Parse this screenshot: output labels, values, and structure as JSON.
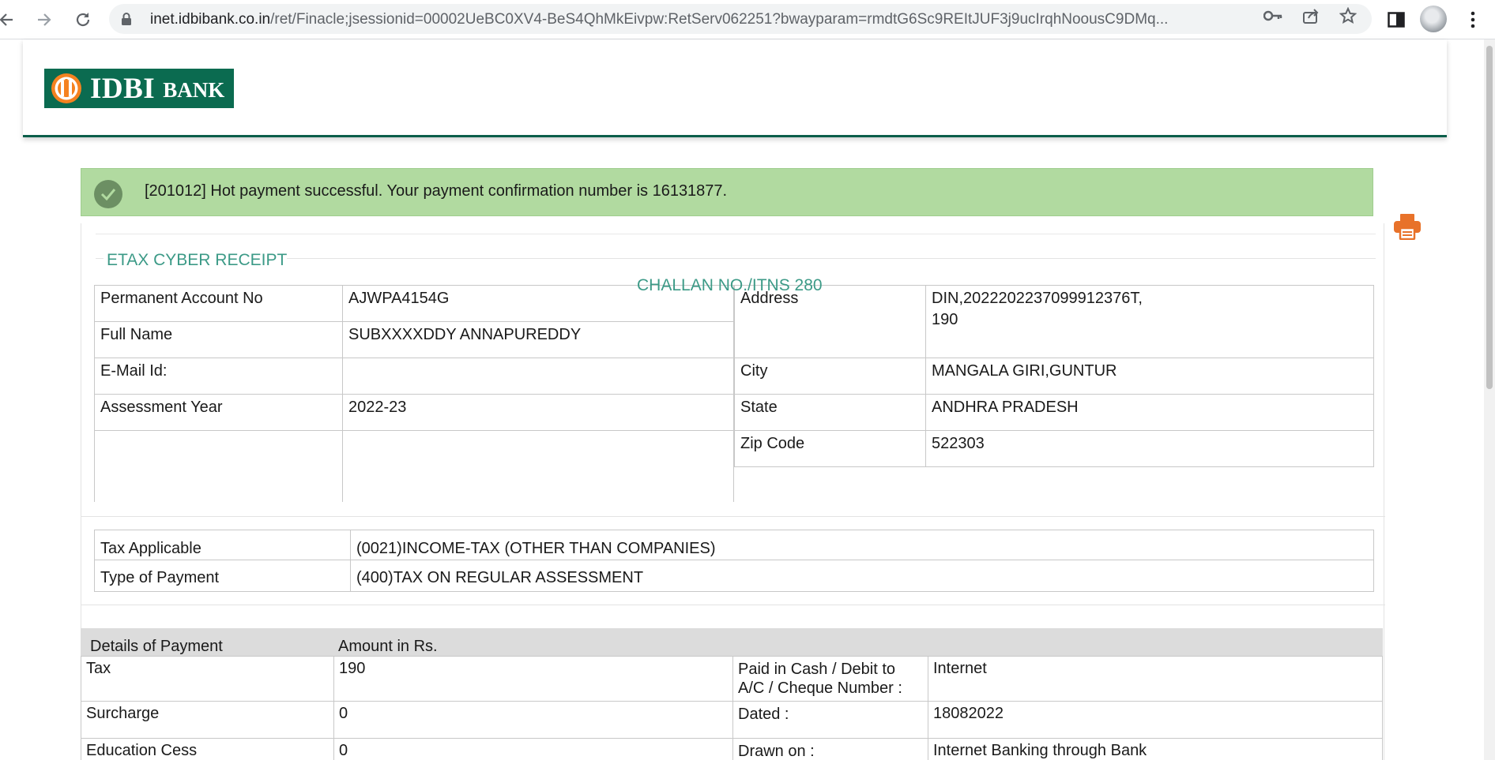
{
  "browser": {
    "url_host": "inet.idbibank.co.in",
    "url_path": "/ret/Finacle;jsessionid=00002UeBC0XV4-BeS4QhMkEivpw:RetServ062251?bwayparam=rmdtG6Sc9REItJUF3j9ucIrqhNoousC9DMq..."
  },
  "brand": {
    "name_part1": "IDBI",
    "name_part2": "BANK",
    "color": "#0b6b50"
  },
  "alert": {
    "message": "[201012] Hot payment successful. Your payment confirmation number is 16131877.",
    "color": "#b1daa0"
  },
  "receipt": {
    "legend": "ETAX CYBER RECEIPT",
    "challan": "CHALLAN NO./ITNS 280",
    "left_rows": [
      {
        "label": "Permanent Account No",
        "value": "AJWPA4154G"
      },
      {
        "label": "Full Name",
        "value": "SUBXXXXDDY ANNAPUREDDY"
      },
      {
        "label": "E-Mail Id:",
        "value": ""
      },
      {
        "label": "Assessment Year",
        "value": "2022-23"
      }
    ],
    "right_rows": [
      {
        "label": "Address",
        "value_line1": "DIN,2022202237099912376T,",
        "value_line2": "190"
      },
      {
        "label": "City",
        "value": "MANGALA GIRI,GUNTUR"
      },
      {
        "label": "State",
        "value": "ANDHRA PRADESH"
      },
      {
        "label": "Zip Code",
        "value": "522303"
      }
    ],
    "tax_rows": [
      {
        "label": "Tax Applicable",
        "value": "(0021)INCOME-TAX (OTHER THAN COMPANIES)"
      },
      {
        "label": "Type of Payment",
        "value": "(400)TAX ON REGULAR ASSESSMENT"
      }
    ]
  },
  "payment": {
    "header_col1": "Details of Payment",
    "header_col2": "Amount in Rs.",
    "rows": [
      {
        "label": "Tax",
        "amount": "190",
        "info_label": "Paid in Cash / Debit to A/C / Cheque Number :",
        "info_value": "Internet"
      },
      {
        "label": "Surcharge",
        "amount": "0",
        "info_label": "Dated :",
        "info_value": "18082022"
      },
      {
        "label": "Education Cess",
        "amount": "0",
        "info_label": "Drawn on :",
        "info_value": "Internet Banking through Bank"
      }
    ]
  },
  "icons": {
    "back": "arrow-left-icon",
    "forward": "arrow-right-icon",
    "reload": "reload-icon",
    "lock": "lock-icon",
    "key": "key-icon",
    "share": "share-icon",
    "star": "star-icon",
    "side_panel": "side-panel-icon",
    "menu": "kebab-menu-icon",
    "check": "check-circle-icon",
    "print": "printer-icon"
  },
  "accent_color": "#3c9a87",
  "print_color": "#e8722a"
}
